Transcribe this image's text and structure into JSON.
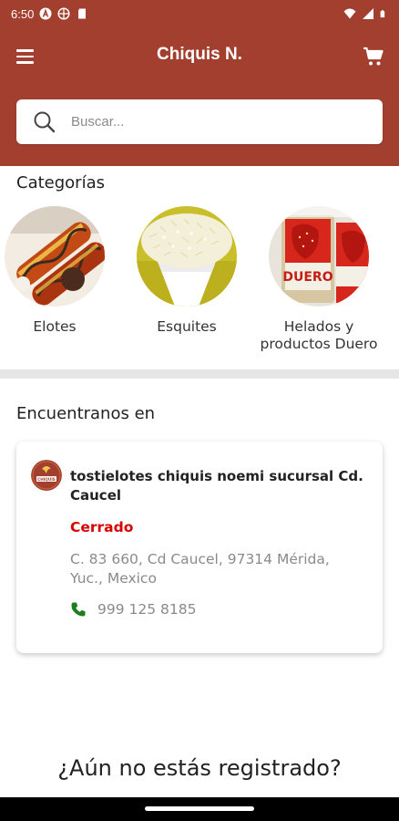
{
  "status_bar": {
    "time": "6:50",
    "left_icons": [
      "notification-a-icon",
      "vpn-icon",
      "sd-card-icon"
    ],
    "right_icons": [
      "wifi-icon",
      "signal-icon",
      "battery-icon"
    ]
  },
  "app_bar": {
    "title": "Chiquis N.",
    "menu_icon": "hamburger-menu-icon",
    "cart_icon": "shopping-cart-icon",
    "background_color": "#a33f2f"
  },
  "search": {
    "placeholder": "Buscar...",
    "value": ""
  },
  "categories": {
    "title": "Categorías",
    "items": [
      {
        "label": "Elotes"
      },
      {
        "label": "Esquites"
      },
      {
        "label": "Helados y productos Duero",
        "image_text": "DUERO"
      }
    ]
  },
  "locations": {
    "title": "Encuentranos en",
    "stores": [
      {
        "name": "tostielotes chiquis noemi sucursal Cd. Caucel",
        "status": "Cerrado",
        "status_color": "#d90000",
        "address": "C. 83 660, Cd Caucel, 97314 Mérida, Yuc., Mexico",
        "phone": "999 125 8185",
        "logo_text": "CHIQUIS"
      }
    ]
  },
  "register": {
    "title": "¿Aún no estás registrado?"
  }
}
